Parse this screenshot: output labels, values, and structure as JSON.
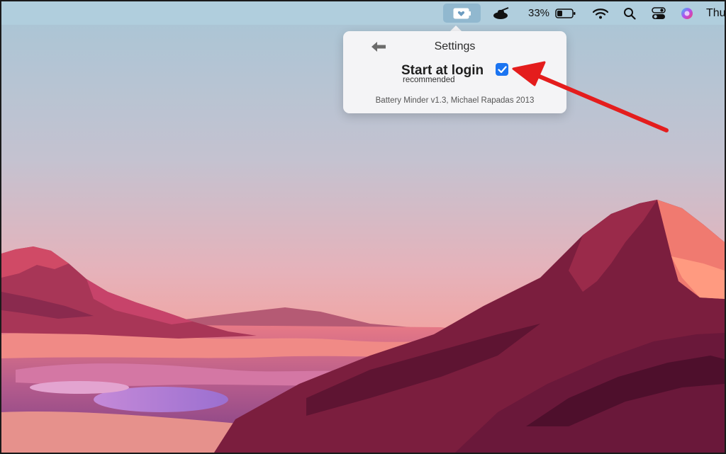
{
  "menubar": {
    "battery_percent": "33%",
    "clock_partial": "Thu",
    "icons": [
      "battery-minder-heart-icon",
      "tank-icon",
      "battery-icon",
      "wifi-icon",
      "search-icon",
      "control-center-icon",
      "siri-icon"
    ]
  },
  "popover": {
    "title": "Settings",
    "back_icon": "arrow-left-icon",
    "start_at_login_label": "Start at login",
    "start_at_login_checked": true,
    "recommended_text": "recommended",
    "version_text": "Battery Minder v1.3, Michael Rapadas 2013"
  },
  "colors": {
    "accent": "#1b74f1",
    "annotation_arrow": "#e41d1d",
    "menubar": "#b0cede"
  }
}
